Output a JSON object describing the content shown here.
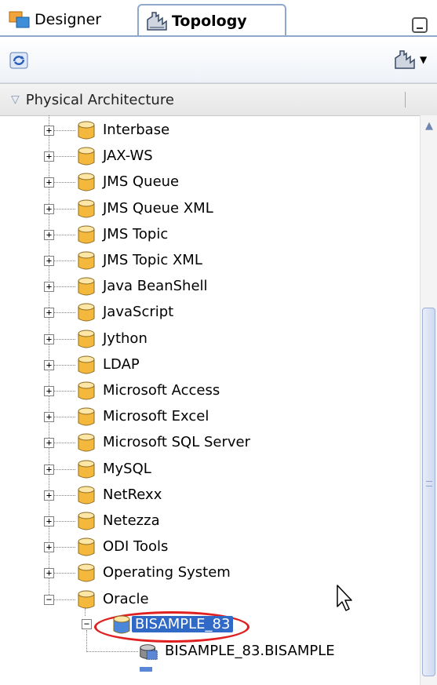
{
  "tabs": [
    {
      "label": "Designer",
      "icon": "designer-icon",
      "active": false
    },
    {
      "label": "Topology",
      "icon": "topology-icon",
      "active": true
    }
  ],
  "toolbar": {
    "refresh_icon": "refresh-icon",
    "menu_icon": "topology-menu-icon"
  },
  "accordion": {
    "title": "Physical Architecture",
    "expanded": true
  },
  "tree": {
    "items": [
      {
        "label": "Interbase",
        "icon": "technology-icon",
        "expander": "+"
      },
      {
        "label": "JAX-WS",
        "icon": "technology-icon",
        "expander": "+"
      },
      {
        "label": "JMS Queue",
        "icon": "technology-icon",
        "expander": "+"
      },
      {
        "label": "JMS Queue XML",
        "icon": "technology-icon",
        "expander": "+"
      },
      {
        "label": "JMS Topic",
        "icon": "technology-icon",
        "expander": "+"
      },
      {
        "label": "JMS Topic XML",
        "icon": "technology-icon",
        "expander": "+"
      },
      {
        "label": "Java BeanShell",
        "icon": "technology-icon",
        "expander": "+"
      },
      {
        "label": "JavaScript",
        "icon": "technology-icon",
        "expander": "+"
      },
      {
        "label": "Jython",
        "icon": "technology-icon",
        "expander": "+"
      },
      {
        "label": "LDAP",
        "icon": "technology-icon",
        "expander": "+"
      },
      {
        "label": "Microsoft Access",
        "icon": "technology-icon",
        "expander": "+"
      },
      {
        "label": "Microsoft Excel",
        "icon": "technology-icon",
        "expander": "+"
      },
      {
        "label": "Microsoft SQL Server",
        "icon": "technology-icon",
        "expander": "+"
      },
      {
        "label": "MySQL",
        "icon": "technology-icon",
        "expander": "+"
      },
      {
        "label": "NetRexx",
        "icon": "technology-icon",
        "expander": "+"
      },
      {
        "label": "Netezza",
        "icon": "technology-icon",
        "expander": "+"
      },
      {
        "label": "ODI Tools",
        "icon": "technology-icon",
        "expander": "+"
      },
      {
        "label": "Operating System",
        "icon": "technology-icon",
        "expander": "+"
      },
      {
        "label": "Oracle",
        "icon": "technology-icon",
        "expander": "−"
      }
    ],
    "data_server": {
      "label": "BISAMPLE_83",
      "icon": "data-server-icon",
      "expander": "−",
      "selected": true
    },
    "physical_schema": {
      "label": "BISAMPLE_83.BISAMPLE",
      "icon": "physical-schema-icon"
    }
  },
  "colors": {
    "selection": "#3169c6",
    "highlight_ring": "#e02020",
    "cylinder": "#f4b93c"
  }
}
